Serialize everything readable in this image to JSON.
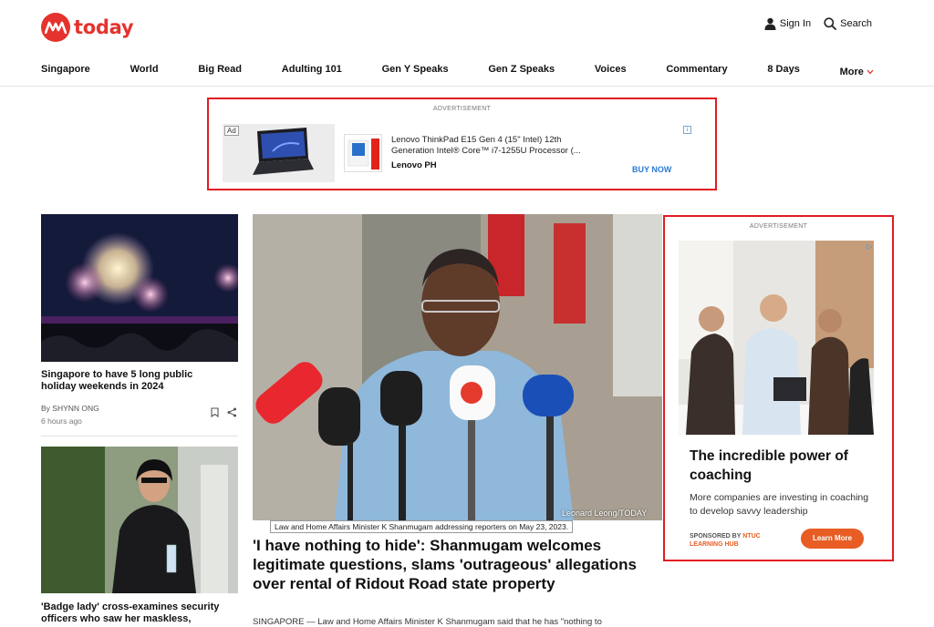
{
  "brand": {
    "name": "today",
    "color": "#e5322d"
  },
  "header": {
    "sign_in": "Sign In",
    "search": "Search"
  },
  "nav": {
    "items": [
      "Singapore",
      "World",
      "Big Read",
      "Adulting 101",
      "Gen Y Speaks",
      "Gen Z Speaks",
      "Voices",
      "Commentary",
      "8 Days"
    ],
    "more": "More"
  },
  "top_ad": {
    "label": "ADVERTISEMENT",
    "badge": "Ad",
    "text": "Lenovo ThinkPad E15 Gen 4 (15\" Intel) 12th Generation Intel® Core™ i7-1255U Processor (...",
    "brand": "Lenovo PH",
    "cta": "BUY NOW",
    "info_icon": "info-icon"
  },
  "stories": [
    {
      "title": "Singapore to have 5 long public holiday weekends in 2024",
      "byline": "By SHYNN ONG",
      "time": "6 hours ago"
    },
    {
      "title": "'Badge lady' cross-examines security officers who saw her maskless,"
    }
  ],
  "main_story": {
    "credit": "Leonard Leong/TODAY",
    "caption": "Law and Home Affairs Minister K Shanmugam addressing reporters on May 23, 2023.",
    "title": "'I have nothing to hide': Shanmugam welcomes legitimate questions, slams 'outrageous' allegations over rental of Ridout Road state property",
    "lede": "SINGAPORE — Law and Home Affairs Minister K Shanmugam said that he has \"nothing to"
  },
  "side_ad": {
    "label": "ADVERTISEMENT",
    "headline": "The incredible power of coaching",
    "body": "More companies are investing in coaching to develop savvy leadership",
    "sponsor_prefix": "SPONSORED BY",
    "sponsor_brand": "NTUC LEARNING HUB",
    "cta": "Learn More"
  },
  "colors": {
    "accent": "#e5322d",
    "ad_border": "#e31b23",
    "cta_orange": "#e85d24",
    "link_blue": "#2b7bd1"
  }
}
